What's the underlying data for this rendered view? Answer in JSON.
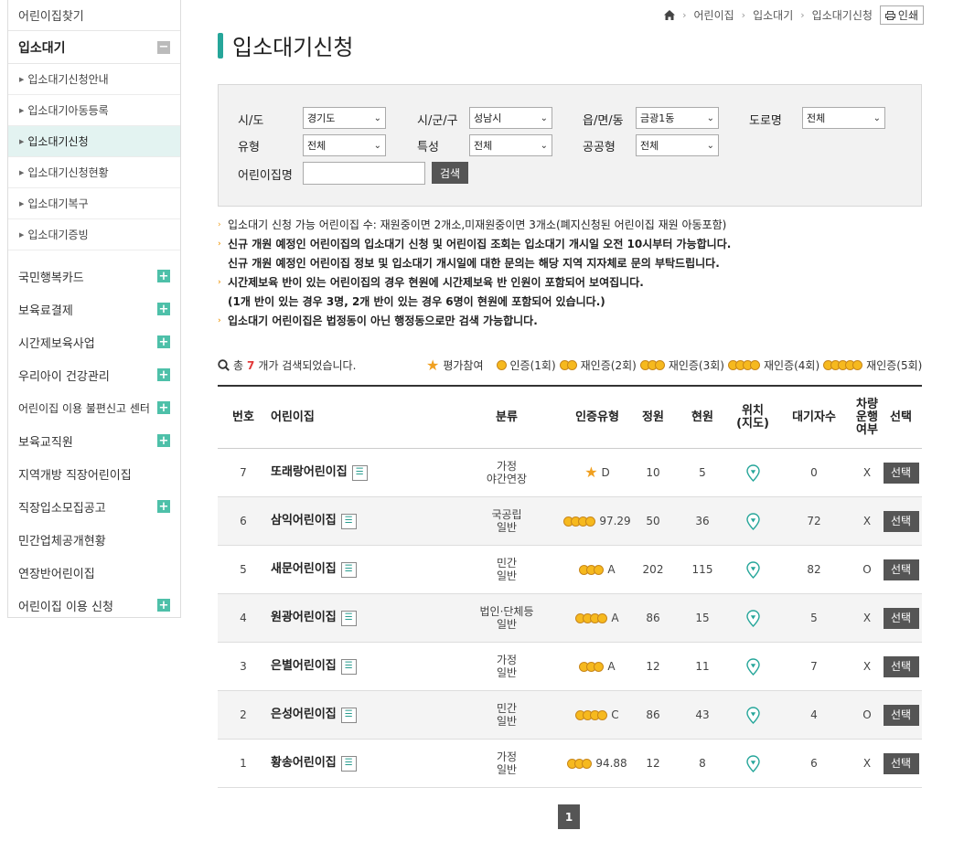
{
  "sidebar": {
    "top_item": "어린이집찾기",
    "section": "입소대기",
    "section_toggle": "−",
    "sub_items": [
      {
        "label": "입소대기신청안내",
        "active": false
      },
      {
        "label": "입소대기아동등록",
        "active": false
      },
      {
        "label": "입소대기신청",
        "active": true
      },
      {
        "label": "입소대기신청현황",
        "active": false
      },
      {
        "label": "입소대기복구",
        "active": false
      },
      {
        "label": "입소대기증빙",
        "active": false
      }
    ],
    "main_items": [
      {
        "label": "국민행복카드",
        "expandable": true
      },
      {
        "label": "보육료결제",
        "expandable": true
      },
      {
        "label": "시간제보육사업",
        "expandable": true
      },
      {
        "label": "우리아이 건강관리",
        "expandable": true
      },
      {
        "label": "어린이집 이용 불편신고 센터",
        "expandable": true
      },
      {
        "label": "보육교직원",
        "expandable": true
      },
      {
        "label": "지역개방 직장어린이집",
        "expandable": false
      },
      {
        "label": "직장입소모집공고",
        "expandable": true
      },
      {
        "label": "민간업체공개현황",
        "expandable": false
      },
      {
        "label": "연장반어린이집",
        "expandable": false
      },
      {
        "label": "어린이집 이용 신청",
        "expandable": true
      }
    ]
  },
  "breadcrumb": [
    "어린이집",
    "입소대기",
    "입소대기신청"
  ],
  "print_label": "인쇄",
  "page_title": "입소대기신청",
  "filter": {
    "sido_label": "시/도",
    "sido_value": "경기도",
    "sigungu_label": "시/군/구",
    "sigungu_value": "성남시",
    "emd_label": "읍/면/동",
    "emd_value": "금광1동",
    "road_label": "도로명",
    "road_value": "전체",
    "type_label": "유형",
    "type_value": "전체",
    "feature_label": "특성",
    "feature_value": "전체",
    "public_label": "공공형",
    "public_value": "전체",
    "name_label": "어린이집명",
    "name_value": "",
    "search_label": "검색"
  },
  "notes": {
    "n1": "입소대기 신청 가능 어린이집 수: 재원중이면 2개소,미재원중이면 3개소(폐지신청된 어린이집 재원 아동포함)",
    "n2a": "신규 개원 예정인 어린이집의 입소대기 신청 및 어린이집 조회는 입소대기 개시일 오전 10시부터 가능합니다.",
    "n2b": "신규 개원 예정인 어린이집 정보 및 입소대기 개시일에 대한 문의는 해당 지역 지자체로 문의 부탁드립니다.",
    "n3a": "시간제보육 반이 있는 어린이집의 경우 현원에 시간제보육 반 인원이 포함되어 보여집니다.",
    "n3b": "(1개 반이 있는 경우 3명, 2개 반이 있는 경우 6명이 현원에 포함되어 있습니다.)",
    "n4": "입소대기 어린이집은 법정동이 아닌 행정동으로만 검색 가능합니다."
  },
  "results": {
    "prefix": "총",
    "count": "7",
    "suffix": "개가 검색되었습니다."
  },
  "legend": {
    "eval": "평가참여",
    "c1": "인증(1회)",
    "c2": "재인증(2회)",
    "c3": "재인증(3회)",
    "c4": "재인증(4회)",
    "c5": "재인증(5회)"
  },
  "table": {
    "headers": {
      "no": "번호",
      "name": "어린이집",
      "cat": "분류",
      "cert": "인증유형",
      "cap": "정원",
      "cur": "현원",
      "loc1": "위치",
      "loc2": "(지도)",
      "wait": "대기자수",
      "bus1": "차량",
      "bus2": "운행",
      "bus3": "여부",
      "sel": "선택"
    },
    "rows": [
      {
        "no": "7",
        "name": "또래랑어린이집",
        "cat1": "가정",
        "cat2": "야간연장",
        "medals": 0,
        "eval": true,
        "grade": "D",
        "cap": "10",
        "cur": "5",
        "wait": "0",
        "bus": "X",
        "sel": "선택"
      },
      {
        "no": "6",
        "name": "삼익어린이집",
        "cat1": "국공립",
        "cat2": "일반",
        "medals": 4,
        "eval": false,
        "grade": "97.29",
        "cap": "50",
        "cur": "36",
        "wait": "72",
        "bus": "X",
        "sel": "선택"
      },
      {
        "no": "5",
        "name": "새문어린이집",
        "cat1": "민간",
        "cat2": "일반",
        "medals": 3,
        "eval": false,
        "grade": "A",
        "cap": "202",
        "cur": "115",
        "wait": "82",
        "bus": "O",
        "sel": "선택"
      },
      {
        "no": "4",
        "name": "원광어린이집",
        "cat1": "법인·단체등",
        "cat2": "일반",
        "medals": 4,
        "eval": false,
        "grade": "A",
        "cap": "86",
        "cur": "15",
        "wait": "5",
        "bus": "X",
        "sel": "선택"
      },
      {
        "no": "3",
        "name": "은별어린이집",
        "cat1": "가정",
        "cat2": "일반",
        "medals": 3,
        "eval": false,
        "grade": "A",
        "cap": "12",
        "cur": "11",
        "wait": "7",
        "bus": "X",
        "sel": "선택"
      },
      {
        "no": "2",
        "name": "은성어린이집",
        "cat1": "민간",
        "cat2": "일반",
        "medals": 4,
        "eval": false,
        "grade": "C",
        "cap": "86",
        "cur": "43",
        "wait": "4",
        "bus": "O",
        "sel": "선택"
      },
      {
        "no": "1",
        "name": "황송어린이집",
        "cat1": "가정",
        "cat2": "일반",
        "medals": 3,
        "eval": false,
        "grade": "94.88",
        "cap": "12",
        "cur": "8",
        "wait": "6",
        "bus": "X",
        "sel": "선택"
      }
    ]
  },
  "pagination": {
    "current": "1"
  },
  "colors": {
    "accent": "#26a69a",
    "plus": "#4ec0a9",
    "button": "#555555",
    "count": "#e23a3a",
    "notice": "#f0a020"
  }
}
